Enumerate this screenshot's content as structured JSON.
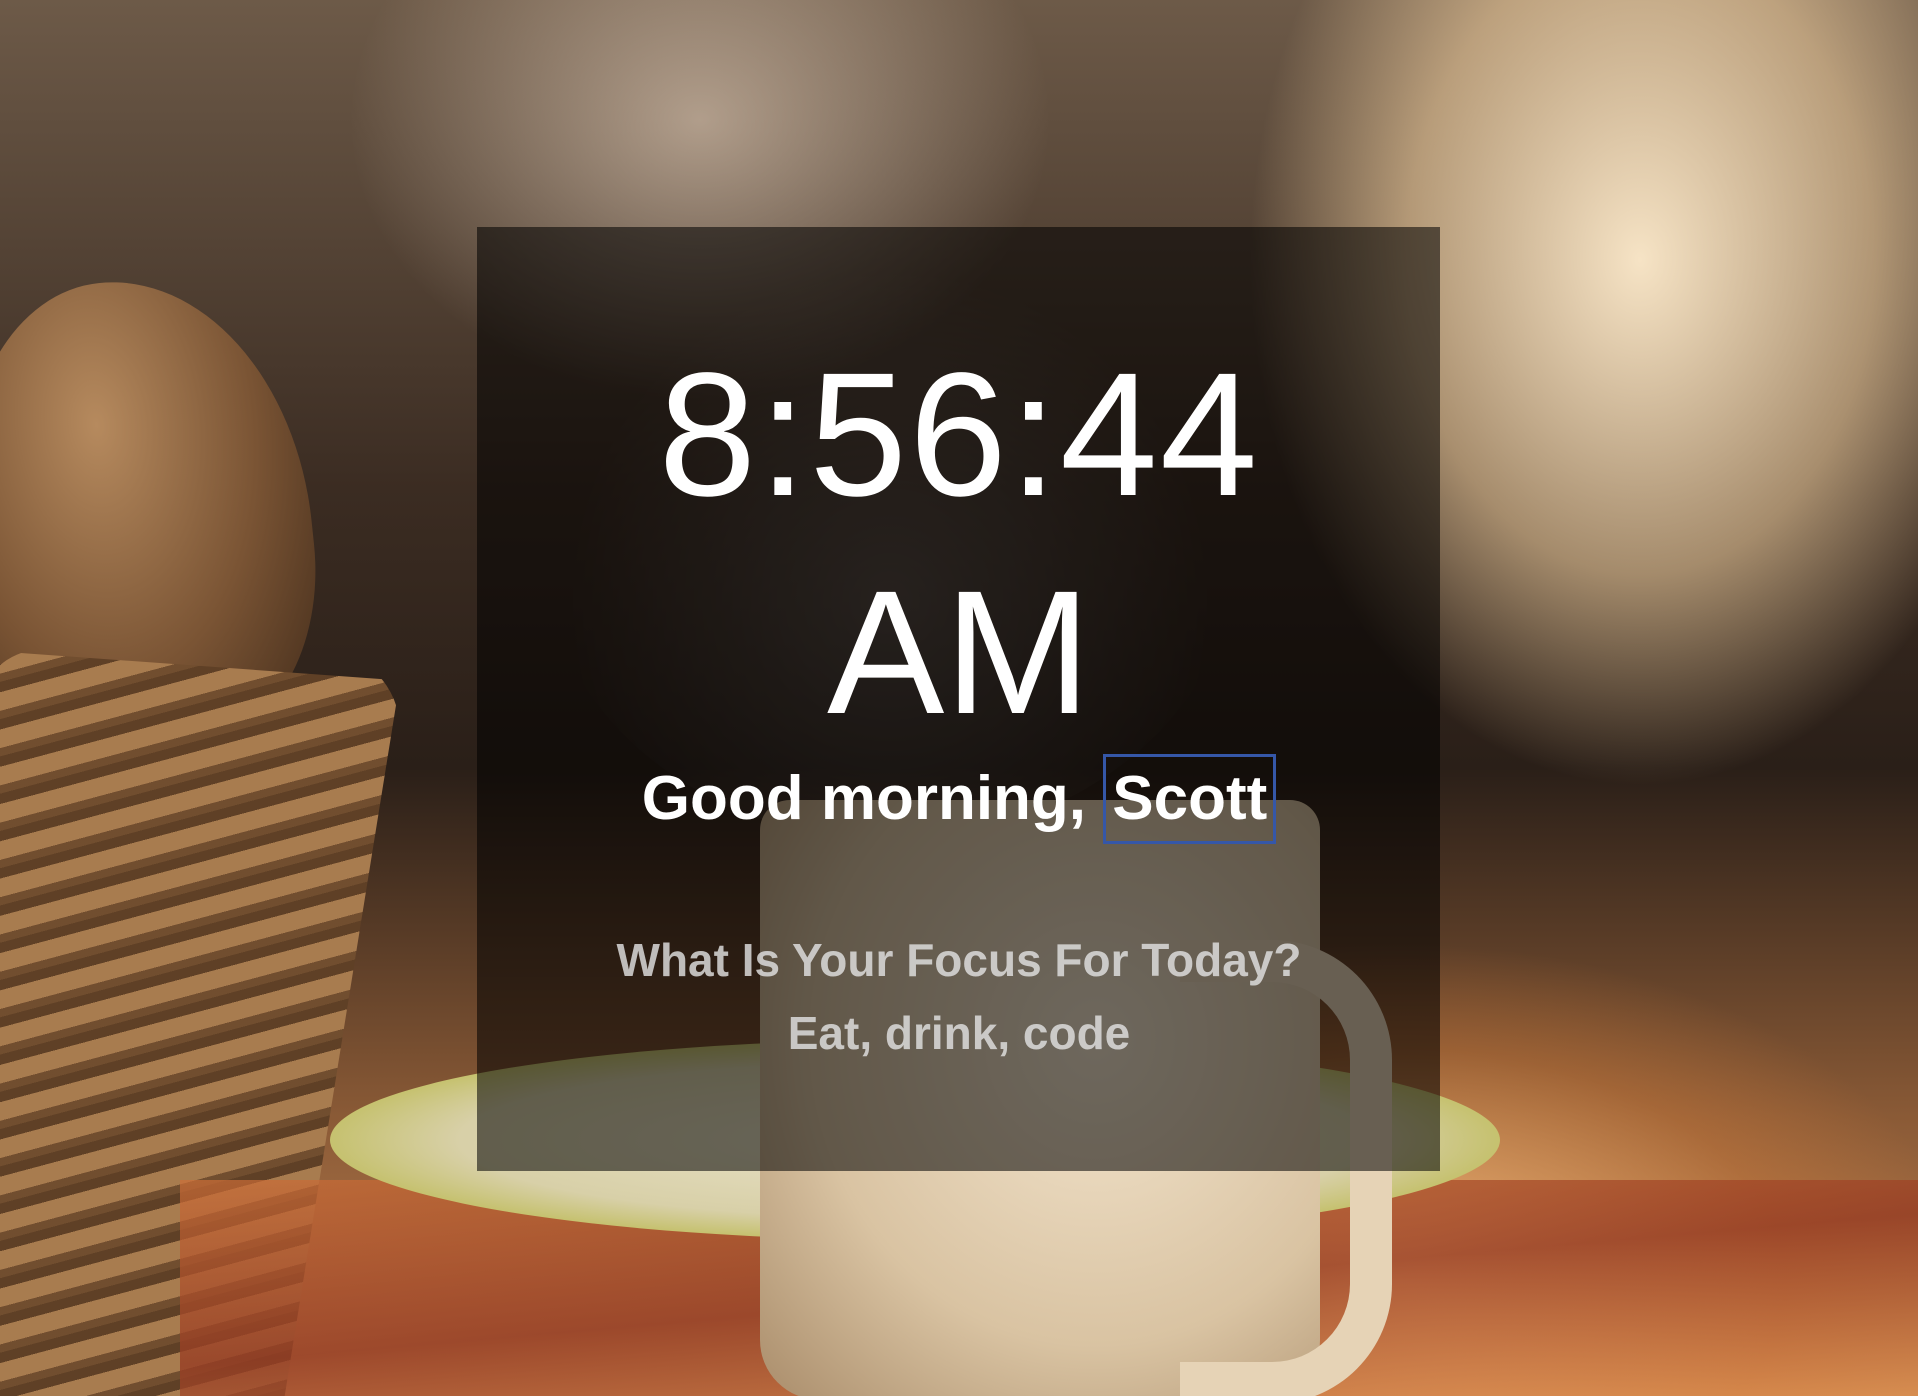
{
  "clock": {
    "time": "8:56:44",
    "meridiem": "AM"
  },
  "greeting": {
    "text": "Good morning, ",
    "name": "Scott"
  },
  "focus": {
    "question": "What Is Your Focus For Today?",
    "answer": "Eat, drink, code"
  },
  "colors": {
    "panel_overlay": "#000000",
    "text": "#ffffff",
    "name_outline": "#3557a8"
  }
}
